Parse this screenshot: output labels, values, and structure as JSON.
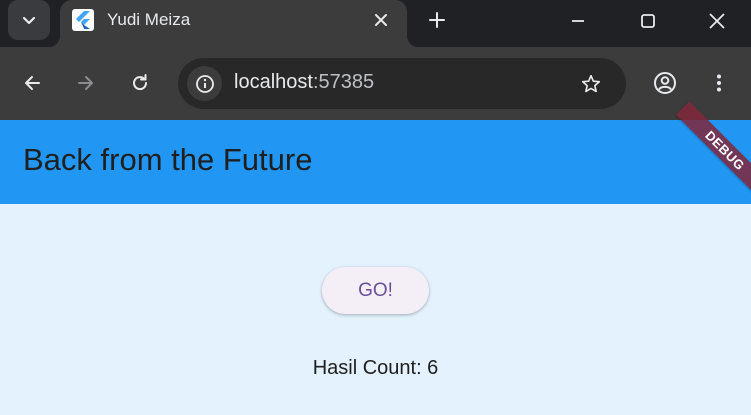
{
  "browser": {
    "tab": {
      "title": "Yudi Meiza",
      "favicon": "flutter-logo-icon"
    },
    "address_bar": {
      "host": "localhost",
      "port": ":57385"
    },
    "icons": {
      "tab_search": "chevron-down-icon",
      "close_tab": "close-icon",
      "new_tab": "plus-icon",
      "minimize": "minimize-icon",
      "maximize": "maximize-icon",
      "close_window": "close-icon",
      "back": "arrow-left-icon",
      "forward": "arrow-right-icon",
      "reload": "reload-icon",
      "site_info": "info-icon",
      "bookmark": "star-icon",
      "profile": "account-circle-icon",
      "menu": "more-vert-icon"
    }
  },
  "app": {
    "title": "Back from the Future",
    "debug_banner": "DEBUG",
    "go_button_label": "GO!",
    "result_text": "Hasil Count: 6"
  },
  "colors": {
    "app_bar": "#2196f3",
    "background": "#e3f2fd",
    "button_bg": "#f4eff7",
    "button_text": "#6a4f9a",
    "debug_banner": "#80273a"
  }
}
